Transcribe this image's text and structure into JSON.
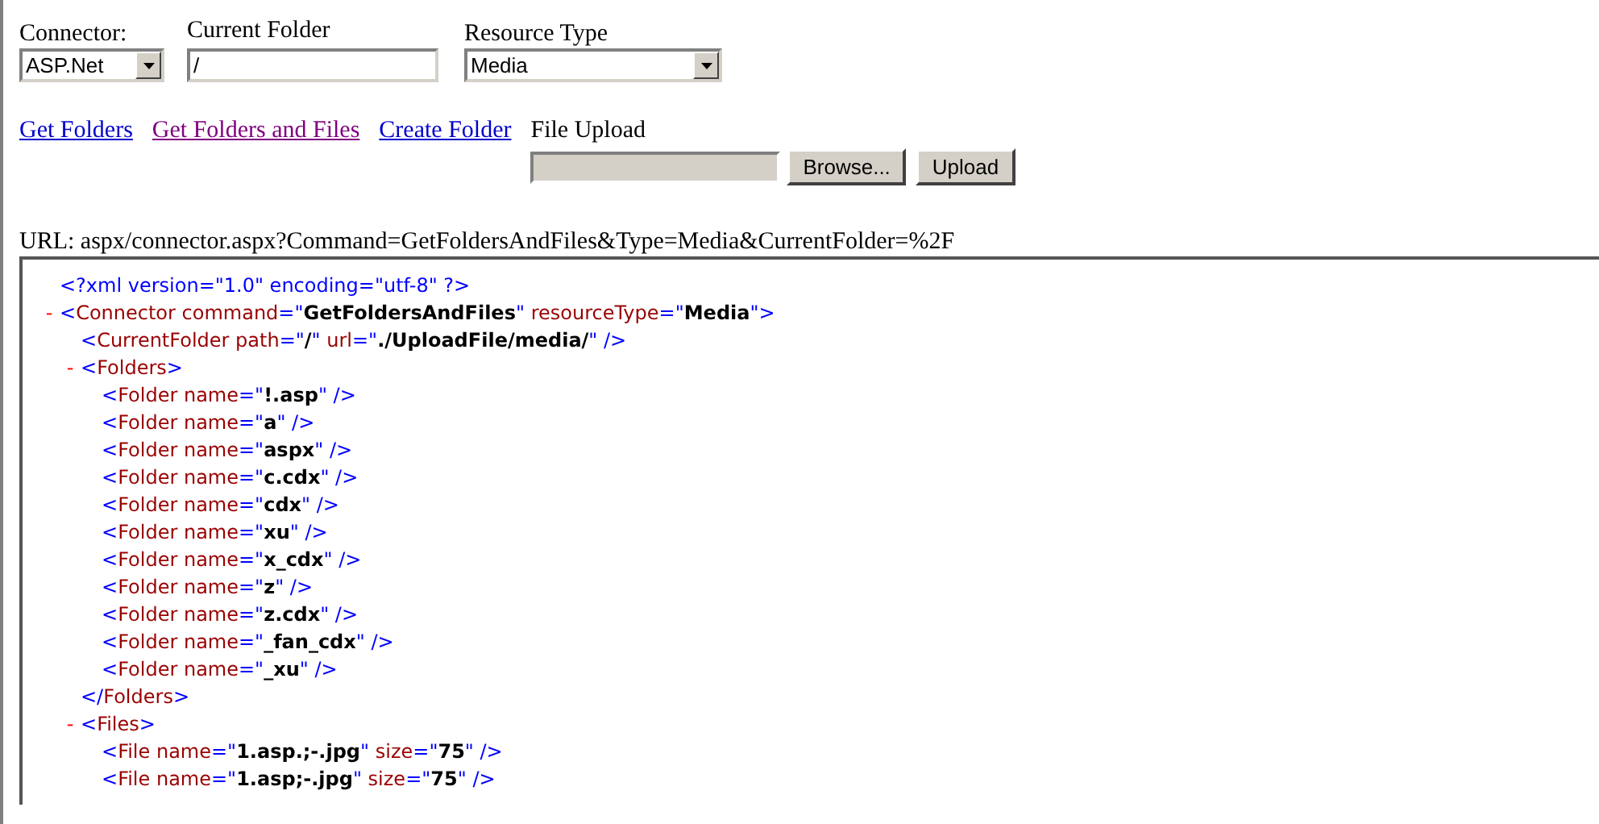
{
  "form": {
    "connector": {
      "label": "Connector:",
      "value": "ASP.Net"
    },
    "current_folder": {
      "label": "Current Folder",
      "value": "/"
    },
    "resource_type": {
      "label": "Resource Type",
      "value": "Media"
    }
  },
  "links": [
    {
      "label": "Get Folders",
      "visited": false
    },
    {
      "label": "Get Folders and Files",
      "visited": true
    },
    {
      "label": "Create Folder",
      "visited": false
    }
  ],
  "upload": {
    "label": "File Upload",
    "browse": "Browse...",
    "submit": "Upload"
  },
  "url": "URL: aspx/connector.aspx?Command=GetFoldersAndFiles&Type=Media&CurrentFolder=%2F",
  "xml": [
    {
      "tokens": [
        {
          "kind": "punct",
          "text": "<?xml version=\"1.0\" encoding=\"utf-8\" ?>"
        }
      ]
    },
    {
      "toggle": "-",
      "tokens": [
        {
          "kind": "punct",
          "text": "<"
        },
        {
          "kind": "name",
          "text": "Connector command"
        },
        {
          "kind": "punct",
          "text": "=\""
        },
        {
          "kind": "value",
          "text": "GetFoldersAndFiles"
        },
        {
          "kind": "punct",
          "text": "\" "
        },
        {
          "kind": "name",
          "text": "resourceType"
        },
        {
          "kind": "punct",
          "text": "=\""
        },
        {
          "kind": "value",
          "text": "Media"
        },
        {
          "kind": "punct",
          "text": "\">"
        }
      ],
      "children": [
        {
          "tokens": [
            {
              "kind": "punct",
              "text": "<"
            },
            {
              "kind": "name",
              "text": "CurrentFolder path"
            },
            {
              "kind": "punct",
              "text": "=\""
            },
            {
              "kind": "value",
              "text": "/"
            },
            {
              "kind": "punct",
              "text": "\" "
            },
            {
              "kind": "name",
              "text": "url"
            },
            {
              "kind": "punct",
              "text": "=\""
            },
            {
              "kind": "value",
              "text": "./UploadFile/media/"
            },
            {
              "kind": "punct",
              "text": "\" />"
            }
          ]
        },
        {
          "toggle": "-",
          "tokens": [
            {
              "kind": "punct",
              "text": "<"
            },
            {
              "kind": "name",
              "text": "Folders"
            },
            {
              "kind": "punct",
              "text": ">"
            }
          ],
          "children": [
            {
              "tokens": [
                {
                  "kind": "punct",
                  "text": "<"
                },
                {
                  "kind": "name",
                  "text": "Folder name"
                },
                {
                  "kind": "punct",
                  "text": "=\""
                },
                {
                  "kind": "value",
                  "text": "!.asp"
                },
                {
                  "kind": "punct",
                  "text": "\" />"
                }
              ]
            },
            {
              "tokens": [
                {
                  "kind": "punct",
                  "text": "<"
                },
                {
                  "kind": "name",
                  "text": "Folder name"
                },
                {
                  "kind": "punct",
                  "text": "=\""
                },
                {
                  "kind": "value",
                  "text": "a"
                },
                {
                  "kind": "punct",
                  "text": "\" />"
                }
              ]
            },
            {
              "tokens": [
                {
                  "kind": "punct",
                  "text": "<"
                },
                {
                  "kind": "name",
                  "text": "Folder name"
                },
                {
                  "kind": "punct",
                  "text": "=\""
                },
                {
                  "kind": "value",
                  "text": "aspx"
                },
                {
                  "kind": "punct",
                  "text": "\" />"
                }
              ]
            },
            {
              "tokens": [
                {
                  "kind": "punct",
                  "text": "<"
                },
                {
                  "kind": "name",
                  "text": "Folder name"
                },
                {
                  "kind": "punct",
                  "text": "=\""
                },
                {
                  "kind": "value",
                  "text": "c.cdx"
                },
                {
                  "kind": "punct",
                  "text": "\" />"
                }
              ]
            },
            {
              "tokens": [
                {
                  "kind": "punct",
                  "text": "<"
                },
                {
                  "kind": "name",
                  "text": "Folder name"
                },
                {
                  "kind": "punct",
                  "text": "=\""
                },
                {
                  "kind": "value",
                  "text": "cdx"
                },
                {
                  "kind": "punct",
                  "text": "\" />"
                }
              ]
            },
            {
              "tokens": [
                {
                  "kind": "punct",
                  "text": "<"
                },
                {
                  "kind": "name",
                  "text": "Folder name"
                },
                {
                  "kind": "punct",
                  "text": "=\""
                },
                {
                  "kind": "value",
                  "text": "xu"
                },
                {
                  "kind": "punct",
                  "text": "\" />"
                }
              ]
            },
            {
              "tokens": [
                {
                  "kind": "punct",
                  "text": "<"
                },
                {
                  "kind": "name",
                  "text": "Folder name"
                },
                {
                  "kind": "punct",
                  "text": "=\""
                },
                {
                  "kind": "value",
                  "text": "x_cdx"
                },
                {
                  "kind": "punct",
                  "text": "\" />"
                }
              ]
            },
            {
              "tokens": [
                {
                  "kind": "punct",
                  "text": "<"
                },
                {
                  "kind": "name",
                  "text": "Folder name"
                },
                {
                  "kind": "punct",
                  "text": "=\""
                },
                {
                  "kind": "value",
                  "text": "z"
                },
                {
                  "kind": "punct",
                  "text": "\" />"
                }
              ]
            },
            {
              "tokens": [
                {
                  "kind": "punct",
                  "text": "<"
                },
                {
                  "kind": "name",
                  "text": "Folder name"
                },
                {
                  "kind": "punct",
                  "text": "=\""
                },
                {
                  "kind": "value",
                  "text": "z.cdx"
                },
                {
                  "kind": "punct",
                  "text": "\" />"
                }
              ]
            },
            {
              "tokens": [
                {
                  "kind": "punct",
                  "text": "<"
                },
                {
                  "kind": "name",
                  "text": "Folder name"
                },
                {
                  "kind": "punct",
                  "text": "=\""
                },
                {
                  "kind": "value",
                  "text": "_fan_cdx"
                },
                {
                  "kind": "punct",
                  "text": "\" />"
                }
              ]
            },
            {
              "tokens": [
                {
                  "kind": "punct",
                  "text": "<"
                },
                {
                  "kind": "name",
                  "text": "Folder name"
                },
                {
                  "kind": "punct",
                  "text": "=\""
                },
                {
                  "kind": "value",
                  "text": "_xu"
                },
                {
                  "kind": "punct",
                  "text": "\" />"
                }
              ]
            }
          ],
          "close_tokens": [
            {
              "kind": "punct",
              "text": "</"
            },
            {
              "kind": "name",
              "text": "Folders"
            },
            {
              "kind": "punct",
              "text": ">"
            }
          ]
        },
        {
          "toggle": "-",
          "tokens": [
            {
              "kind": "punct",
              "text": "<"
            },
            {
              "kind": "name",
              "text": "Files"
            },
            {
              "kind": "punct",
              "text": ">"
            }
          ],
          "children": [
            {
              "tokens": [
                {
                  "kind": "punct",
                  "text": "<"
                },
                {
                  "kind": "name",
                  "text": "File name"
                },
                {
                  "kind": "punct",
                  "text": "=\""
                },
                {
                  "kind": "value",
                  "text": "1.asp.;-.jpg"
                },
                {
                  "kind": "punct",
                  "text": "\" "
                },
                {
                  "kind": "name",
                  "text": "size"
                },
                {
                  "kind": "punct",
                  "text": "=\""
                },
                {
                  "kind": "value",
                  "text": "75"
                },
                {
                  "kind": "punct",
                  "text": "\" />"
                }
              ]
            },
            {
              "tokens": [
                {
                  "kind": "punct",
                  "text": "<"
                },
                {
                  "kind": "name",
                  "text": "File name"
                },
                {
                  "kind": "punct",
                  "text": "=\""
                },
                {
                  "kind": "value",
                  "text": "1.asp;-.jpg"
                },
                {
                  "kind": "punct",
                  "text": "\" "
                },
                {
                  "kind": "name",
                  "text": "size"
                },
                {
                  "kind": "punct",
                  "text": "=\""
                },
                {
                  "kind": "value",
                  "text": "75"
                },
                {
                  "kind": "punct",
                  "text": "\" />"
                }
              ]
            }
          ]
        }
      ]
    }
  ]
}
